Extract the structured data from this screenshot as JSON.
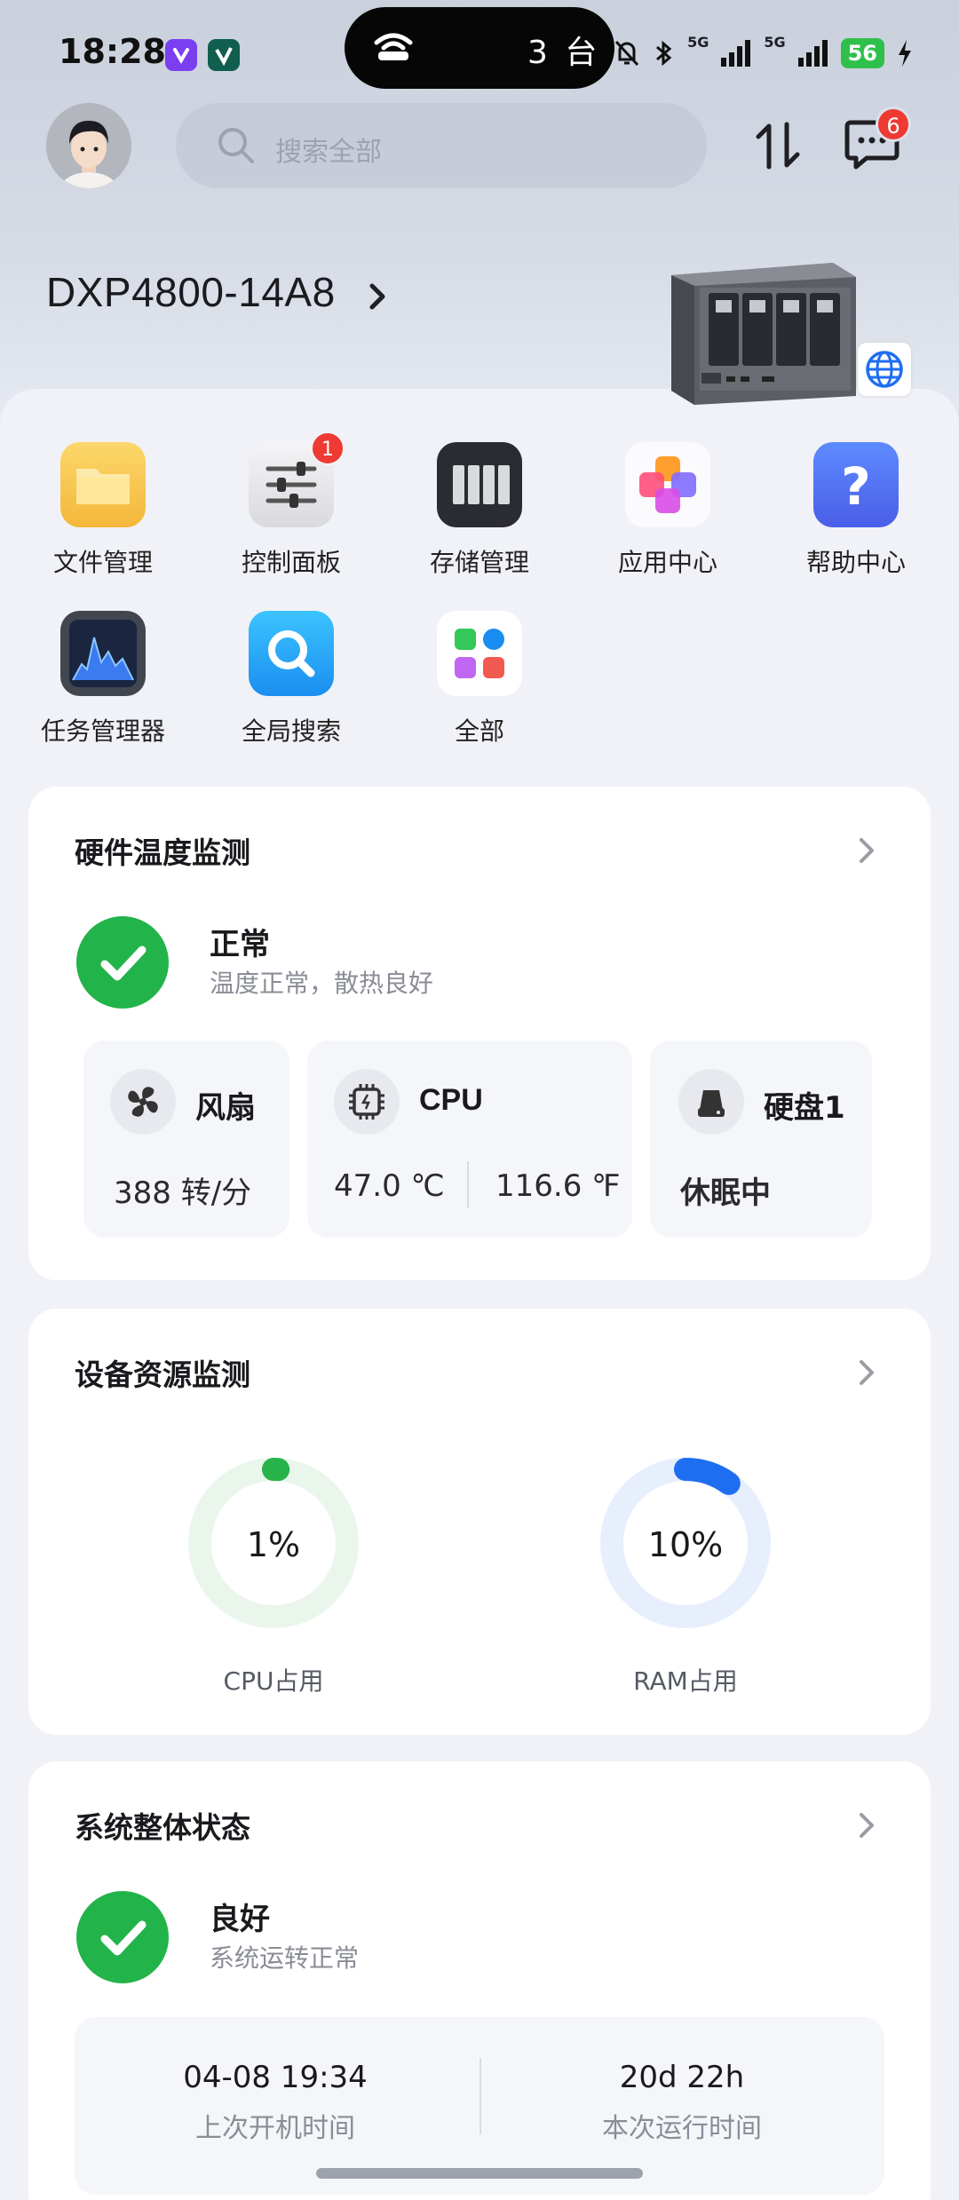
{
  "status_bar": {
    "time": "18:28",
    "island_text": "3 台",
    "battery": "56",
    "signal_1": "5G",
    "signal_2": "5G"
  },
  "header": {
    "search_placeholder": "搜索全部",
    "message_badge": "6",
    "device_name": "DXP4800-14A8"
  },
  "apps": [
    {
      "label": "文件管理",
      "icon": "folder-icon"
    },
    {
      "label": "控制面板",
      "icon": "control-panel-icon",
      "badge": "1"
    },
    {
      "label": "存储管理",
      "icon": "storage-icon"
    },
    {
      "label": "应用中心",
      "icon": "app-center-icon"
    },
    {
      "label": "帮助中心",
      "icon": "help-icon"
    },
    {
      "label": "任务管理器",
      "icon": "task-manager-icon"
    },
    {
      "label": "全局搜索",
      "icon": "global-search-icon"
    },
    {
      "label": "全部",
      "icon": "all-apps-icon"
    }
  ],
  "temperature": {
    "title": "硬件温度监测",
    "status": "正常",
    "status_desc": "温度正常，散热良好",
    "fan_label": "风扇",
    "fan_value": "388 转/分",
    "cpu_label": "CPU",
    "cpu_c": "47.0 ℃",
    "cpu_f": "116.6 ℉",
    "disk_label": "硬盘1",
    "disk_value": "休眠中"
  },
  "resources": {
    "title": "设备资源监测",
    "cpu_value": "1%",
    "cpu_label": "CPU占用",
    "ram_value": "10%",
    "ram_label": "RAM占用",
    "cpu_percent": 1,
    "ram_percent": 10
  },
  "system": {
    "title": "系统整体状态",
    "status": "良好",
    "status_desc": "系统运转正常",
    "boot_time": "04-08 19:34",
    "boot_label": "上次开机时间",
    "uptime": "20d 22h",
    "uptime_label": "本次运行时间"
  },
  "colors": {
    "ok_green": "#22b34a",
    "badge_red": "#ee3a32",
    "cpu_ring": "#27b24a",
    "ram_ring": "#1f6ef2"
  }
}
